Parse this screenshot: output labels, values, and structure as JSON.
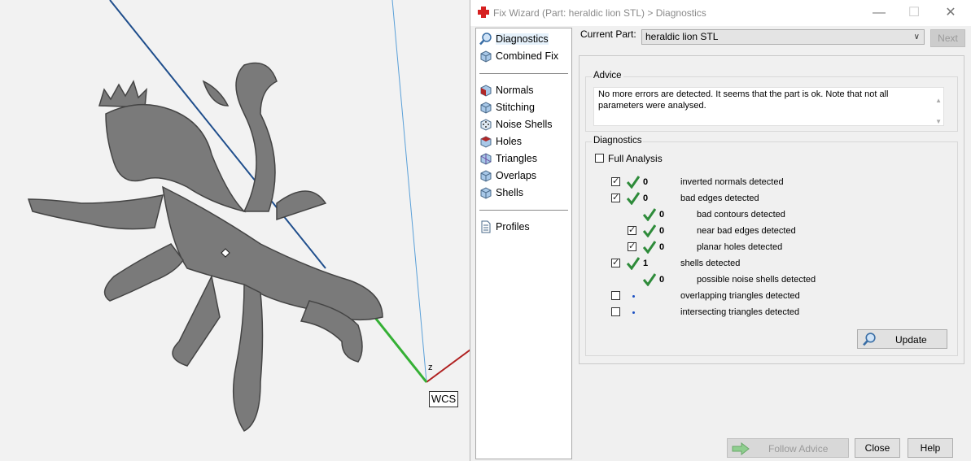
{
  "viewport": {
    "axis_label": "z",
    "wcs_label": "WCS"
  },
  "window": {
    "title": "Fix Wizard (Part: heraldic lion STL) > Diagnostics",
    "minimize": "—",
    "maximize": "☐",
    "close": "✕"
  },
  "nav": {
    "items": [
      {
        "label": "Diagnostics",
        "icon": "magnifier-icon",
        "selected": true
      },
      {
        "label": "Combined Fix",
        "icon": "cube-icon"
      },
      {
        "label": "Normals",
        "icon": "cube-red-face-icon"
      },
      {
        "label": "Stitching",
        "icon": "cube-icon"
      },
      {
        "label": "Noise Shells",
        "icon": "dotted-cube-icon"
      },
      {
        "label": "Holes",
        "icon": "cube-hole-icon"
      },
      {
        "label": "Triangles",
        "icon": "cube-triangle-icon"
      },
      {
        "label": "Overlaps",
        "icon": "cube-icon"
      },
      {
        "label": "Shells",
        "icon": "cube-icon"
      },
      {
        "label": "Profiles",
        "icon": "document-icon"
      }
    ]
  },
  "current_part": {
    "label": "Current Part:",
    "value": "heraldic lion STL"
  },
  "next_button": "Next",
  "advice": {
    "label": "Advice",
    "text": "No more errors are detected. It seems that the part is ok. Note that not all parameters were analysed."
  },
  "diagnostics": {
    "label": "Diagnostics",
    "full_analysis": {
      "label": "Full Analysis",
      "checked": false
    },
    "rows": [
      {
        "checkbox": true,
        "checked": true,
        "status": "ok",
        "count": "0",
        "label": "inverted normals detected"
      },
      {
        "checkbox": true,
        "checked": true,
        "status": "ok",
        "count": "0",
        "label": "bad edges detected"
      },
      {
        "checkbox": false,
        "checked": false,
        "status": "ok",
        "count": "0",
        "label": "bad contours detected"
      },
      {
        "checkbox": true,
        "checked": true,
        "status": "ok",
        "count": "0",
        "label": "near bad edges detected"
      },
      {
        "checkbox": true,
        "checked": true,
        "status": "ok",
        "count": "0",
        "label": "planar holes detected"
      },
      {
        "checkbox": true,
        "checked": true,
        "status": "ok",
        "count": "1",
        "label": "shells detected"
      },
      {
        "checkbox": false,
        "checked": false,
        "status": "ok",
        "count": "0",
        "label": "possible noise shells detected"
      },
      {
        "checkbox": true,
        "checked": false,
        "status": "pending",
        "count": "",
        "label": "overlapping triangles detected"
      },
      {
        "checkbox": true,
        "checked": false,
        "status": "pending",
        "count": "",
        "label": "intersecting triangles detected"
      }
    ],
    "update_button": "Update"
  },
  "footer": {
    "follow_advice": "Follow Advice",
    "close": "Close",
    "help": "Help"
  },
  "colors": {
    "tick": "#2e8b3a",
    "accent_red": "#d62020",
    "pending_dot": "#1a4fc2"
  }
}
